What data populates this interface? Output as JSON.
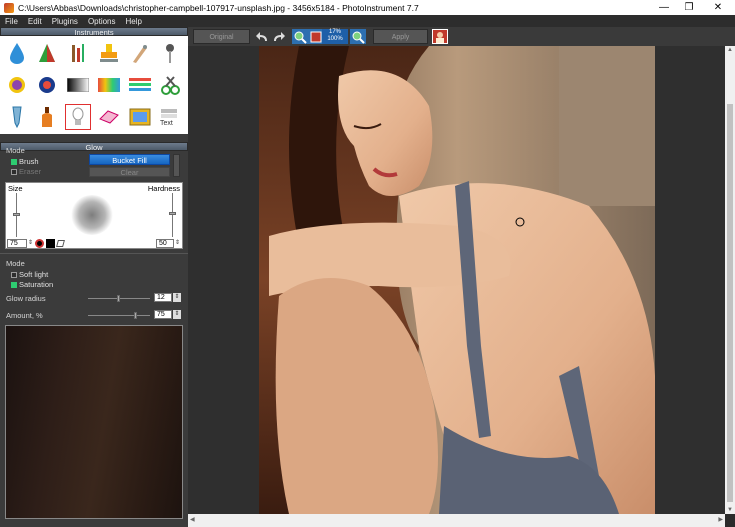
{
  "window": {
    "title": "C:\\Users\\Abbas\\Downloads\\christopher-campbell-107917-unsplash.jpg - 3456x5184 - PhotoInstrument 7.7",
    "minimize": "—",
    "restore": "❐",
    "close": "✕"
  },
  "menu": [
    "File",
    "Edit",
    "Plugins",
    "Options",
    "Help"
  ],
  "instruments": {
    "header": "Instruments",
    "tools": [
      "water-drop-icon",
      "cone-icon",
      "brushes-icon",
      "stamp-icon",
      "smudge-icon",
      "pin-icon",
      "cosmetics-icon",
      "red-eye-icon",
      "gradient-icon",
      "color-palette-icon",
      "color-lines-icon",
      "crop-tool-icon",
      "tube-icon",
      "oil-bottle-icon",
      "glow-bulb-icon",
      "eraser-icon",
      "frame-icon",
      "text-icon"
    ],
    "selected": "glow-bulb-icon",
    "text_tool_label": "Text"
  },
  "glow": {
    "header": "Glow",
    "mode_label": "Mode",
    "brush_label": "Brush",
    "eraser_label": "Eraser",
    "bucket_fill": "Bucket Fill",
    "clear": "Clear",
    "size_label": "Size",
    "hardness_label": "Hardness",
    "size_value": "75",
    "hardness_value": "50",
    "mode2_label": "Mode",
    "soft_light_label": "Soft light",
    "saturation_label": "Saturation",
    "glow_radius_label": "Glow radius",
    "glow_radius_value": "12",
    "amount_label": "Amount, %",
    "amount_value": "75"
  },
  "toolbar": {
    "original": "Original",
    "apply": "Apply",
    "zoom_top": "17%",
    "zoom_bottom": "100%"
  },
  "colors": {
    "accent_blue": "#1565c0",
    "check_green": "#2ecc71",
    "panel_bg": "#3b3b3b",
    "selected_border": "#e03030"
  }
}
